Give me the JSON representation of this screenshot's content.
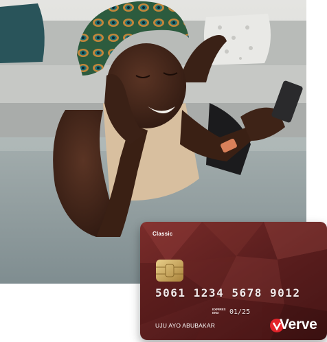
{
  "card": {
    "type_label": "Classic",
    "number": "5061 1234 5678 9012",
    "expires_label": "EXPIRES END",
    "expires_value": "01/25",
    "holder_name": "UJU AYO ABUBAKAR",
    "brand_name": "Verve",
    "colors": {
      "card_base": "#5a1e1e",
      "card_highlight": "#8c3a36",
      "brand_red": "#e3242b",
      "chip_gold": "#c9a24b"
    }
  },
  "photo": {
    "subject": "woman-with-phone-photo",
    "colors": {
      "background_wall": "#d9d9d6",
      "sofa": "#b9bcba",
      "rug": "#8f9c9e",
      "skin": "#3b2218",
      "top": "#d9bf9f",
      "headwrap": "#2f6b4a"
    }
  }
}
